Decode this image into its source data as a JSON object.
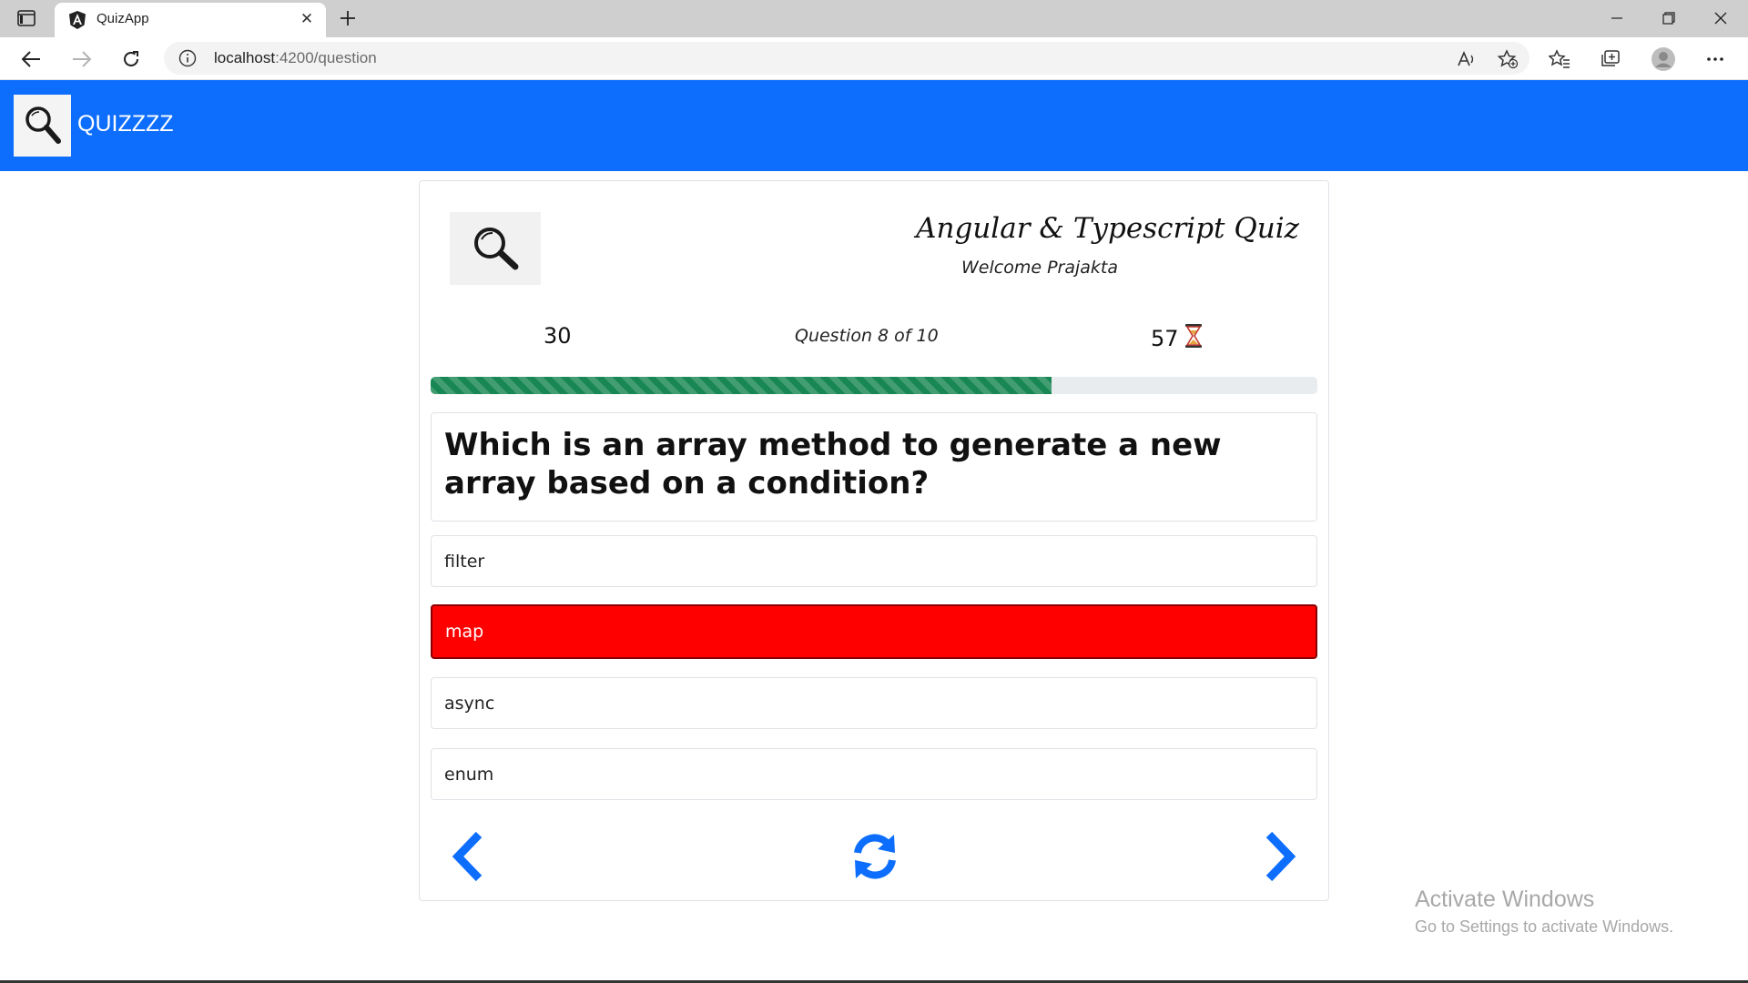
{
  "browser": {
    "tab_title": "QuizApp",
    "url_host": "localhost",
    "url_path": ":4200/question",
    "icons": [
      "tab-actions-icon",
      "angular-favicon-icon",
      "close-icon",
      "plus-icon",
      "minimize-icon",
      "restore-icon",
      "close-window-icon",
      "back-arrow-icon",
      "forward-arrow-icon",
      "refresh-icon",
      "info-icon",
      "read-aloud-icon",
      "add-favorite-icon",
      "favorites-icon",
      "collections-icon",
      "profile-icon",
      "more-icon"
    ]
  },
  "navbar": {
    "brand": "QUIZZZZ",
    "color": "#0d6efd"
  },
  "quiz": {
    "title": "Angular & Typescript Quiz",
    "welcome": "Welcome Prajakta",
    "points": "30",
    "question_counter": "Question 8 of 10",
    "timer": "57",
    "progress_percent": 70,
    "progress_color": "#198754",
    "question": "Which is an array method to generate a new array based on a condition?",
    "options": [
      {
        "label": "filter",
        "selected": false
      },
      {
        "label": "map",
        "selected": true
      },
      {
        "label": "async",
        "selected": false
      },
      {
        "label": "enum",
        "selected": false
      }
    ],
    "selected_color": "#ff0000",
    "controls_color": "#0d6efd"
  },
  "watermark": {
    "line1": "Activate Windows",
    "line2": "Go to Settings to activate Windows."
  }
}
